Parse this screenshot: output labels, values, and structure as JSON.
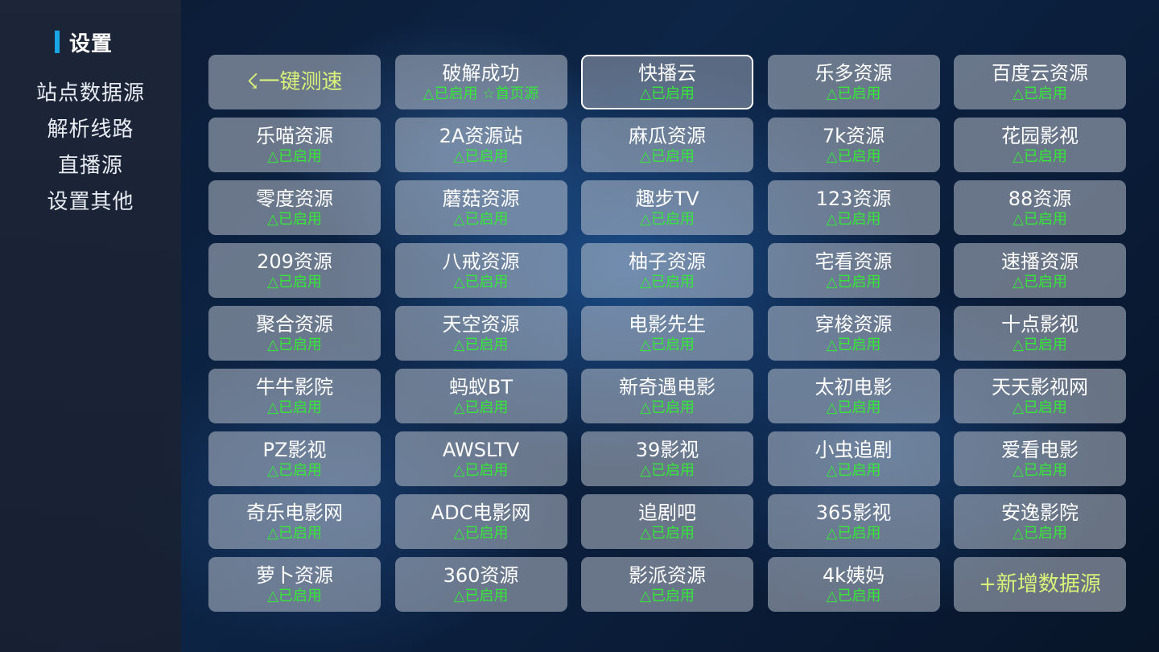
{
  "colors": {
    "accent": "#1aa7e8",
    "status_green": "#35e838",
    "action_yellow": "#d9f27a"
  },
  "sidebar": {
    "title": "设置",
    "items": [
      {
        "label": "站点数据源"
      },
      {
        "label": "解析线路"
      },
      {
        "label": "直播源"
      },
      {
        "label": "设置其他"
      }
    ]
  },
  "grid": {
    "speed_test_label": "☇一键测速",
    "add_source_label": "+新增数据源",
    "tiles": [
      {
        "name": "破解成功",
        "status": "△已启用 ☆首页源"
      },
      {
        "name": "快播云",
        "status": "△已启用"
      },
      {
        "name": "乐多资源",
        "status": "△已启用"
      },
      {
        "name": "百度云资源",
        "status": "△已启用"
      },
      {
        "name": "乐喵资源",
        "status": "△已启用"
      },
      {
        "name": "2A资源站",
        "status": "△已启用"
      },
      {
        "name": "麻瓜资源",
        "status": "△已启用"
      },
      {
        "name": "7k资源",
        "status": "△已启用"
      },
      {
        "name": "花园影视",
        "status": "△已启用"
      },
      {
        "name": "零度资源",
        "status": "△已启用"
      },
      {
        "name": "蘑菇资源",
        "status": "△已启用"
      },
      {
        "name": "趣步TV",
        "status": "△已启用"
      },
      {
        "name": "123资源",
        "status": "△已启用"
      },
      {
        "name": "88资源",
        "status": "△已启用"
      },
      {
        "name": "209资源",
        "status": "△已启用"
      },
      {
        "name": "八戒资源",
        "status": "△已启用"
      },
      {
        "name": "柚子资源",
        "status": "△已启用"
      },
      {
        "name": "宅看资源",
        "status": "△已启用"
      },
      {
        "name": "速播资源",
        "status": "△已启用"
      },
      {
        "name": "聚合资源",
        "status": "△已启用"
      },
      {
        "name": "天空资源",
        "status": "△已启用"
      },
      {
        "name": "电影先生",
        "status": "△已启用"
      },
      {
        "name": "穿梭资源",
        "status": "△已启用"
      },
      {
        "name": "十点影视",
        "status": "△已启用"
      },
      {
        "name": "牛牛影院",
        "status": "△已启用"
      },
      {
        "name": "蚂蚁BT",
        "status": "△已启用"
      },
      {
        "name": "新奇遇电影",
        "status": "△已启用"
      },
      {
        "name": "太初电影",
        "status": "△已启用"
      },
      {
        "name": "天天影视网",
        "status": "△已启用"
      },
      {
        "name": "PZ影视",
        "status": "△已启用"
      },
      {
        "name": "AWSLTV",
        "status": "△已启用"
      },
      {
        "name": "39影视",
        "status": "△已启用"
      },
      {
        "name": "小虫追剧",
        "status": "△已启用"
      },
      {
        "name": "爱看电影",
        "status": "△已启用"
      },
      {
        "name": "奇乐电影网",
        "status": "△已启用"
      },
      {
        "name": "ADC电影网",
        "status": "△已启用"
      },
      {
        "name": "追剧吧",
        "status": "△已启用"
      },
      {
        "name": "365影视",
        "status": "△已启用"
      },
      {
        "name": "安逸影院",
        "status": "△已启用"
      },
      {
        "name": "萝卜资源",
        "status": "△已启用"
      },
      {
        "name": "360资源",
        "status": "△已启用"
      },
      {
        "name": "影派资源",
        "status": "△已启用"
      },
      {
        "name": "4k姨妈",
        "status": "△已启用"
      }
    ]
  }
}
